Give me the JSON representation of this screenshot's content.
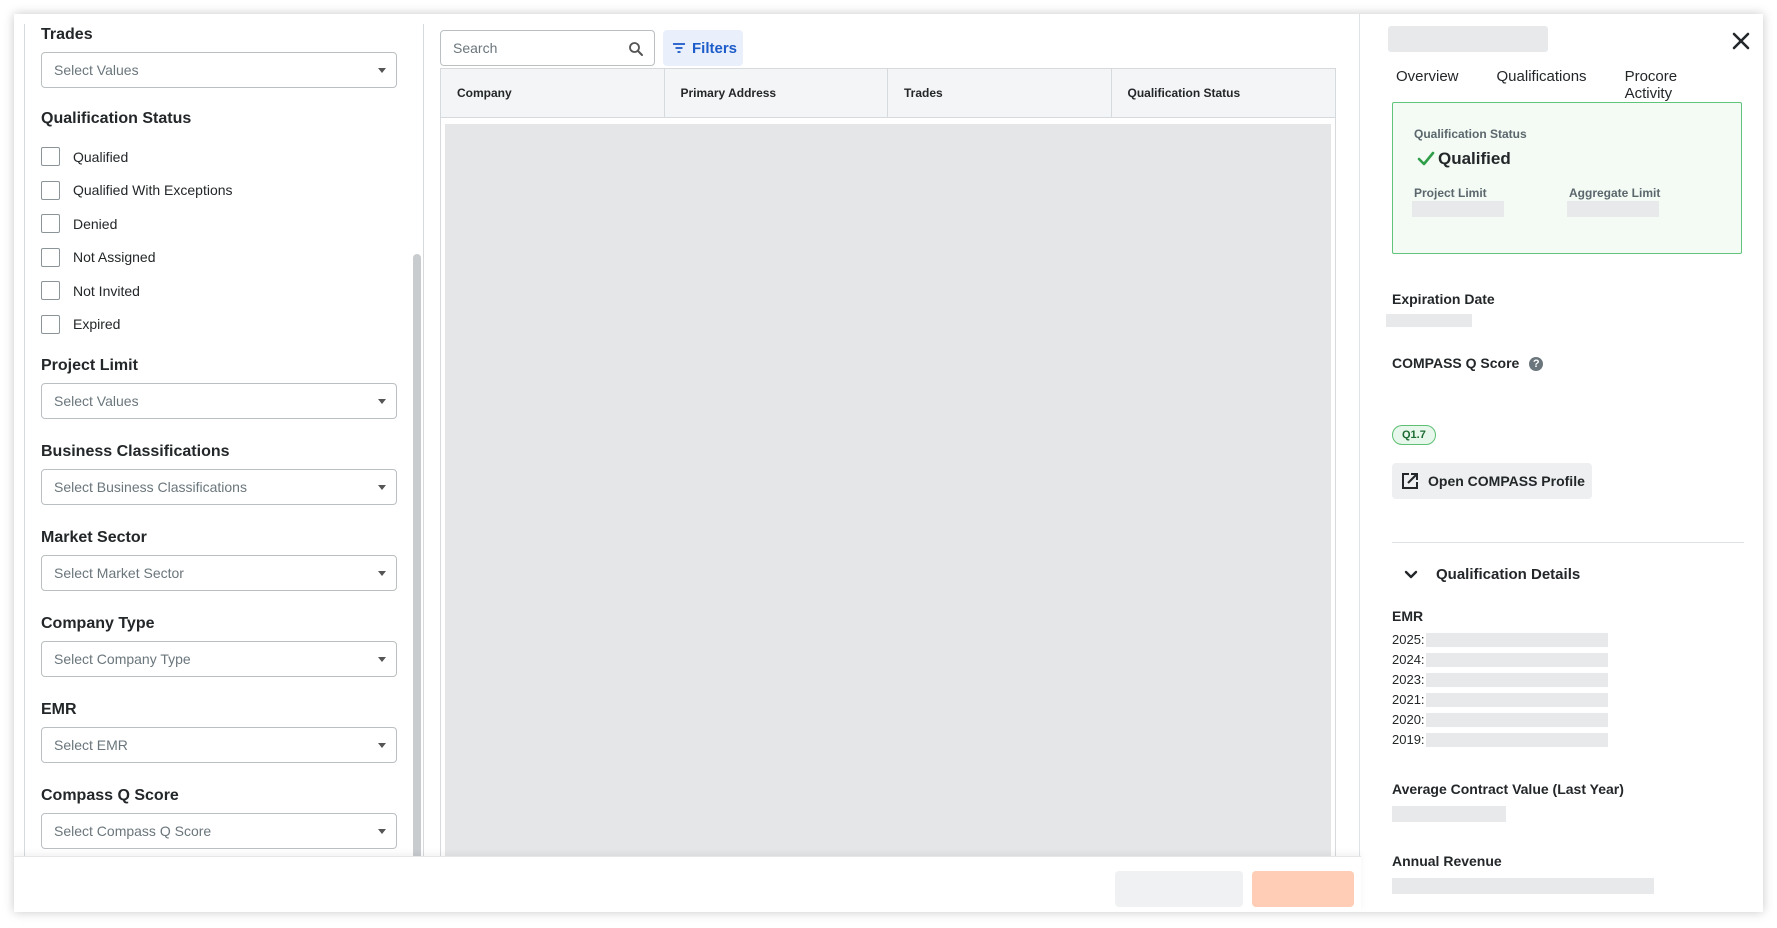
{
  "filters": {
    "trades": {
      "label": "Trades",
      "placeholder": "Select Values"
    },
    "qualification_status": {
      "label": "Qualification Status",
      "options": [
        "Qualified",
        "Qualified With Exceptions",
        "Denied",
        "Not Assigned",
        "Not Invited",
        "Expired"
      ]
    },
    "project_limit": {
      "label": "Project Limit",
      "placeholder": "Select Values"
    },
    "business_classifications": {
      "label": "Business Classifications",
      "placeholder": "Select Business Classifications"
    },
    "market_sector": {
      "label": "Market Sector",
      "placeholder": "Select Market Sector"
    },
    "company_type": {
      "label": "Company Type",
      "placeholder": "Select Company Type"
    },
    "emr": {
      "label": "EMR",
      "placeholder": "Select EMR"
    },
    "compass_q_score": {
      "label": "Compass Q Score",
      "placeholder": "Select Compass Q Score"
    }
  },
  "toolbar": {
    "search_placeholder": "Search",
    "filters_label": "Filters"
  },
  "table": {
    "columns": [
      "Company",
      "Primary Address",
      "Trades",
      "Qualification Status"
    ]
  },
  "detail": {
    "tabs": [
      "Overview",
      "Qualifications",
      "Procore Activity"
    ],
    "active_tab": "Qualifications",
    "qualification_status_label": "Qualification Status",
    "qualification_status_value": "Qualified",
    "project_limit_label": "Project Limit",
    "aggregate_limit_label": "Aggregate Limit",
    "expiration_date_label": "Expiration Date",
    "compass_q_score_label": "COMPASS Q Score",
    "q_score_badge": "Q1.7",
    "open_profile_label": "Open COMPASS Profile",
    "qualification_details_label": "Qualification Details",
    "emr_label": "EMR",
    "emr_years": [
      "2025:",
      "2024:",
      "2023:",
      "2021:",
      "2020:",
      "2019:"
    ],
    "avg_contract_label": "Average Contract Value (Last Year)",
    "annual_revenue_label": "Annual Revenue"
  },
  "colors": {
    "accent_blue": "#1d5cc9",
    "qualified_green": "#2e9e48",
    "primary_orange_disabled": "#ffcdb5"
  },
  "icons": [
    "search-icon",
    "filter-icon",
    "close-icon",
    "check-icon",
    "help-icon",
    "external-link-icon",
    "chevron-down-icon",
    "caret-down-icon"
  ]
}
